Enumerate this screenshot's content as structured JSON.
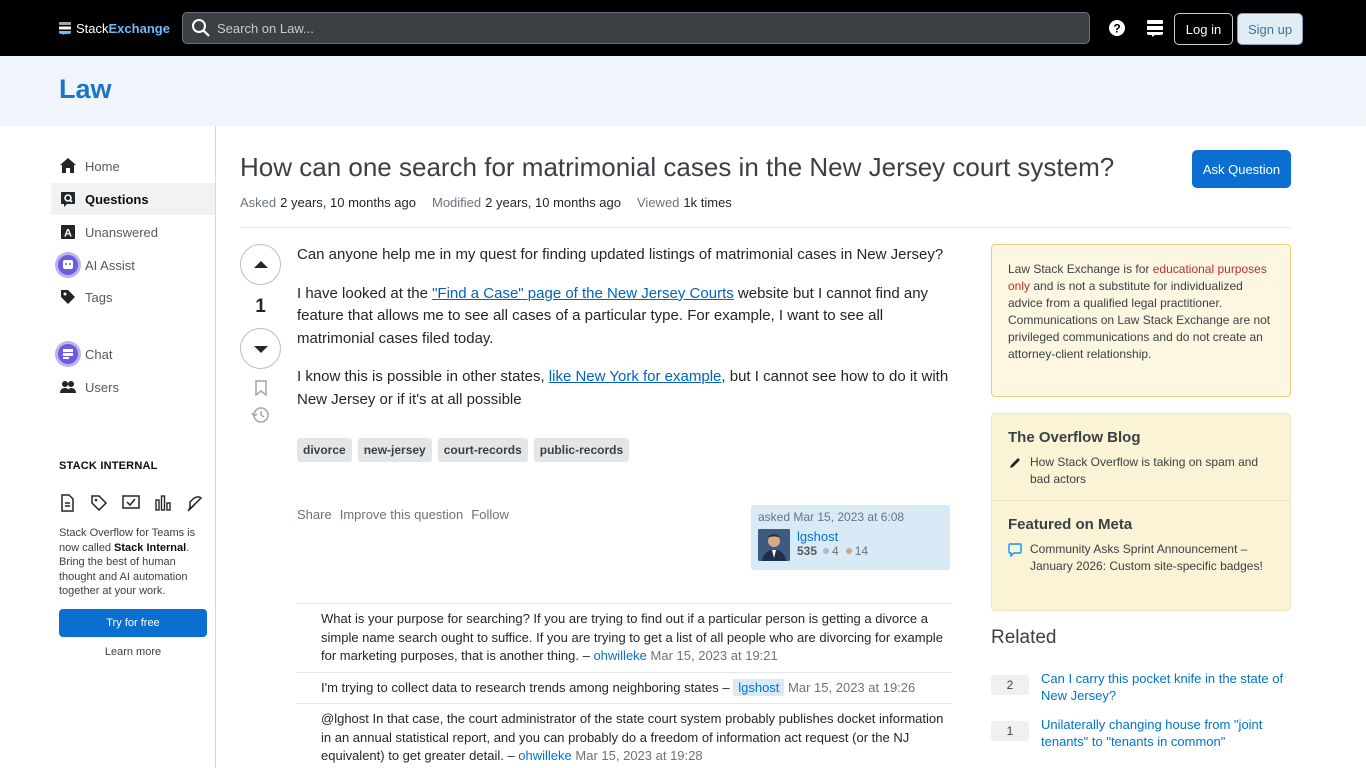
{
  "topbar": {
    "logo_part1": "Stack",
    "logo_part2": "Exchange",
    "search_placeholder": "Search on Law...",
    "login_label": "Log in",
    "signup_label": "Sign up"
  },
  "site": {
    "name": "Law"
  },
  "nav": {
    "items": [
      {
        "label": "Home",
        "icon": "home-icon"
      },
      {
        "label": "Questions",
        "icon": "questions-icon",
        "active": true
      },
      {
        "label": "Unanswered",
        "icon": "unanswered-icon"
      },
      {
        "label": "AI Assist",
        "icon": "ai-assist-icon"
      },
      {
        "label": "Tags",
        "icon": "tag-icon"
      },
      {
        "label": "Chat",
        "icon": "chat-icon"
      },
      {
        "label": "Users",
        "icon": "users-icon"
      }
    ],
    "stack_internal_title": "STACK INTERNAL",
    "stack_internal_desc_1": "Stack Overflow for Teams is now called ",
    "stack_internal_desc_bold": "Stack Internal",
    "stack_internal_desc_2": ". Bring the best of human thought and AI automation together at your work.",
    "try_label": "Try for free",
    "learn_label": "Learn more"
  },
  "question": {
    "title": "How can one search for matrimonial cases in the New Jersey court system?",
    "ask_label": "Ask Question",
    "asked_key": "Asked",
    "asked_val": "2 years, 10 months ago",
    "modified_key": "Modified",
    "modified_val": "2 years, 10 months ago",
    "viewed_key": "Viewed",
    "viewed_val": "1k times",
    "votes": "1",
    "p1": "Can anyone help me in my quest for finding updated listings of matrimonial cases in New Jersey?",
    "p2_a": "I have looked at the ",
    "p2_link": "\"Find a Case\" page of the New Jersey Courts",
    "p2_b": " website but I cannot find any feature that allows me to see all cases of a particular type. For example, I want to see all matrimonial cases filed today.",
    "p3_a": "I know this is possible in other states, ",
    "p3_link": "like New York for example",
    "p3_b": ", but I cannot see how to do it with New Jersey or if it's at all possible",
    "tags": [
      "divorce",
      "new-jersey",
      "court-records",
      "public-records"
    ],
    "actions": [
      "Share",
      "Improve this question",
      "Follow"
    ],
    "asker": {
      "asked": "asked Mar 15, 2023 at 6:08",
      "name": "lgshost",
      "rep": "535",
      "silver": "4",
      "bronze": "14"
    }
  },
  "comments": [
    {
      "text": "What is your purpose for searching? If you are trying to find out if a particular person is getting a divorce a simple name search ought to suffice. If you are trying to get a list of all people who are divorcing for example for marketing purposes, that is another thing. – ",
      "user": "ohwilleke",
      "date": "Mar 15, 2023 at 19:21"
    },
    {
      "text": "I'm trying to collect data to research trends among neighboring states – ",
      "user": "lgshost",
      "date": "Mar 15, 2023 at 19:26"
    },
    {
      "text": "@lghost In that case, the court administrator of the state court system probably publishes docket information in an annual statistical report, and you can probably do a freedom of information act request (or the NJ equivalent) to get greater detail. – ",
      "user": "ohwilleke",
      "date": "Mar 15, 2023 at 19:28"
    }
  ],
  "sidebar": {
    "notice_a": "Law Stack Exchange is for ",
    "notice_red": "educational purposes only",
    "notice_b": " and is not a substitute for individualized advice from a qualified legal practitioner. Communications on Law Stack Exchange are not privileged communications and do not create an attorney-client relationship.",
    "blog_title": "The Overflow Blog",
    "blog_item": "How Stack Overflow is taking on spam and bad actors",
    "meta_title": "Featured on Meta",
    "meta_item": "Community Asks Sprint Announcement – January 2026: Custom site-specific badges!",
    "related_title": "Related",
    "related": [
      {
        "count": "2",
        "title": "Can I carry this pocket knife in the state of New Jersey?"
      },
      {
        "count": "1",
        "title": "Unilaterally changing house from \"joint tenants\" to \"tenants in common\""
      }
    ]
  },
  "colors": {
    "accent": "#0a6fd1",
    "brand": "#1d75c9",
    "notice_bg": "#fdf7e2"
  }
}
